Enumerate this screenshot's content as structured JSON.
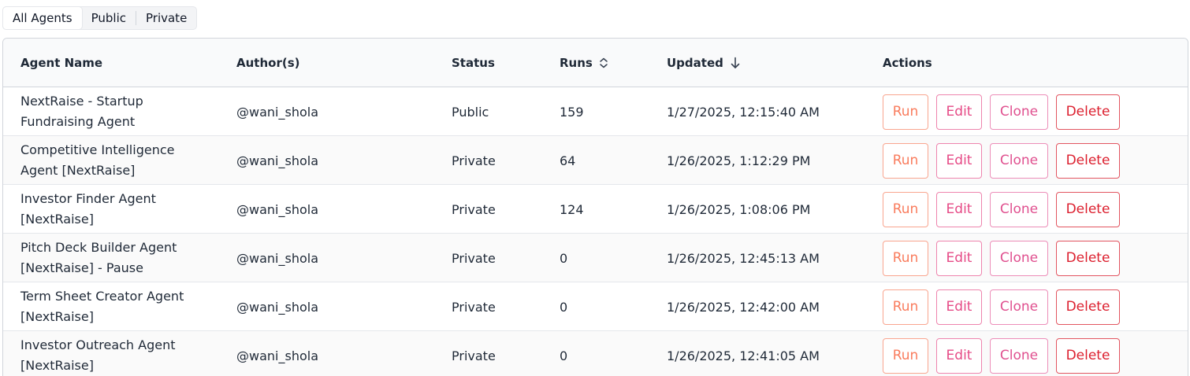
{
  "filter_tabs": [
    {
      "label": "All Agents",
      "active": true
    },
    {
      "label": "Public",
      "active": false
    },
    {
      "label": "Private",
      "active": false
    }
  ],
  "table": {
    "columns": {
      "name": "Agent Name",
      "authors": "Author(s)",
      "status": "Status",
      "runs": "Runs",
      "updated": "Updated",
      "actions": "Actions"
    },
    "sort": {
      "runs": "sortable-icon",
      "updated": "arrow-down-icon"
    },
    "action_labels": {
      "run": "Run",
      "edit": "Edit",
      "clone": "Clone",
      "delete": "Delete"
    },
    "rows": [
      {
        "name": "NextRaise - Startup Fundraising Agent",
        "author": "@wani_shola",
        "status": "Public",
        "runs": "159",
        "updated": "1/27/2025, 12:15:40 AM"
      },
      {
        "name": "Competitive Intelligence Agent [NextRaise]",
        "author": "@wani_shola",
        "status": "Private",
        "runs": "64",
        "updated": "1/26/2025, 1:12:29 PM"
      },
      {
        "name": "Investor Finder Agent [NextRaise]",
        "author": "@wani_shola",
        "status": "Private",
        "runs": "124",
        "updated": "1/26/2025, 1:08:06 PM"
      },
      {
        "name": "Pitch Deck Builder Agent [NextRaise] - Pause",
        "author": "@wani_shola",
        "status": "Private",
        "runs": "0",
        "updated": "1/26/2025, 12:45:13 AM"
      },
      {
        "name": "Term Sheet Creator Agent [NextRaise]",
        "author": "@wani_shola",
        "status": "Private",
        "runs": "0",
        "updated": "1/26/2025, 12:42:00 AM"
      },
      {
        "name": "Investor Outreach Agent [NextRaise]",
        "author": "@wani_shola",
        "status": "Private",
        "runs": "0",
        "updated": "1/26/2025, 12:41:05 AM"
      }
    ]
  },
  "colors": {
    "run": "#f97b5c",
    "edit": "#e64a86",
    "clone": "#e0508f",
    "delete": "#dc1f2e"
  }
}
